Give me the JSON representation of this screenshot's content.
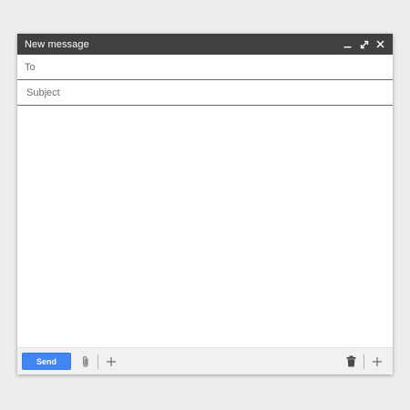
{
  "compose": {
    "title": "New message",
    "controls": {
      "minimize_icon": "minimize-icon",
      "expand_icon": "expand-icon",
      "close_icon": "close-icon"
    },
    "to_label": "To",
    "to_value": "",
    "subject_placeholder": "Subject",
    "subject_value": "",
    "body_value": ""
  },
  "toolbar": {
    "send_label": "Send",
    "icons": [
      "paperclip-icon",
      "plus-icon",
      "trash-icon",
      "plus-icon"
    ]
  },
  "colors": {
    "titlebar": "#404040",
    "send_button": "#4285f4",
    "toolbar_bg": "#f1f1f1",
    "page_bg": "#ededed"
  }
}
